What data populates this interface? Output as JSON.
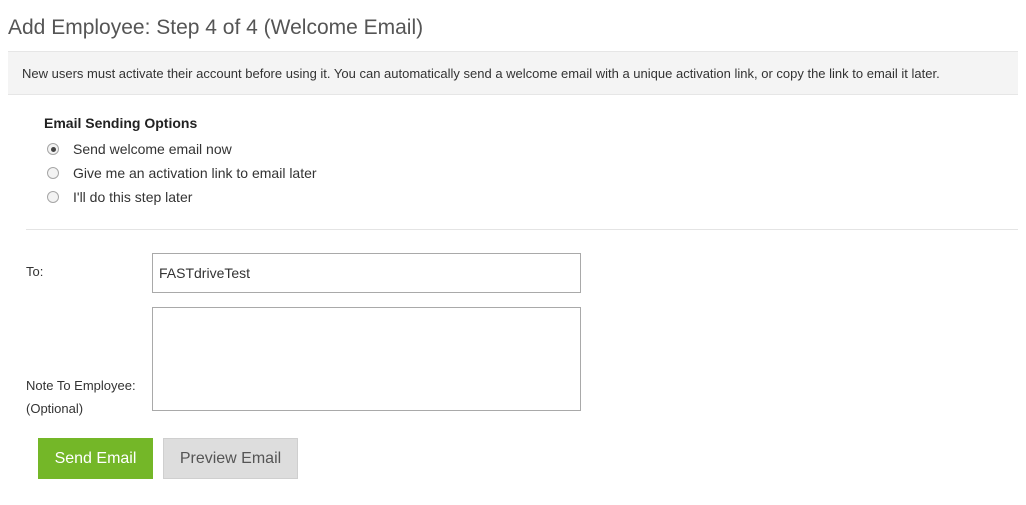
{
  "page": {
    "title": "Add Employee: Step 4 of 4 (Welcome Email)"
  },
  "banner": {
    "text": "New users must activate their account before using it. You can automatically send a welcome email with a unique activation link, or copy the link to email it later."
  },
  "email_options": {
    "title": "Email Sending Options",
    "options": [
      {
        "label": "Send welcome email now",
        "checked": true
      },
      {
        "label": "Give me an activation link to email later",
        "checked": false
      },
      {
        "label": "I'll do this step later",
        "checked": false
      }
    ]
  },
  "form": {
    "to_label": "To:",
    "to_value": "FASTdriveTest",
    "note_label_line1": "Note To Employee:",
    "note_label_line2": "(Optional)",
    "note_value": ""
  },
  "buttons": {
    "send_label": "Send Email",
    "preview_label": "Preview Email"
  },
  "colors": {
    "primary_button": "#74b728",
    "secondary_button": "#dddddd",
    "banner_background": "#f4f4f4"
  }
}
